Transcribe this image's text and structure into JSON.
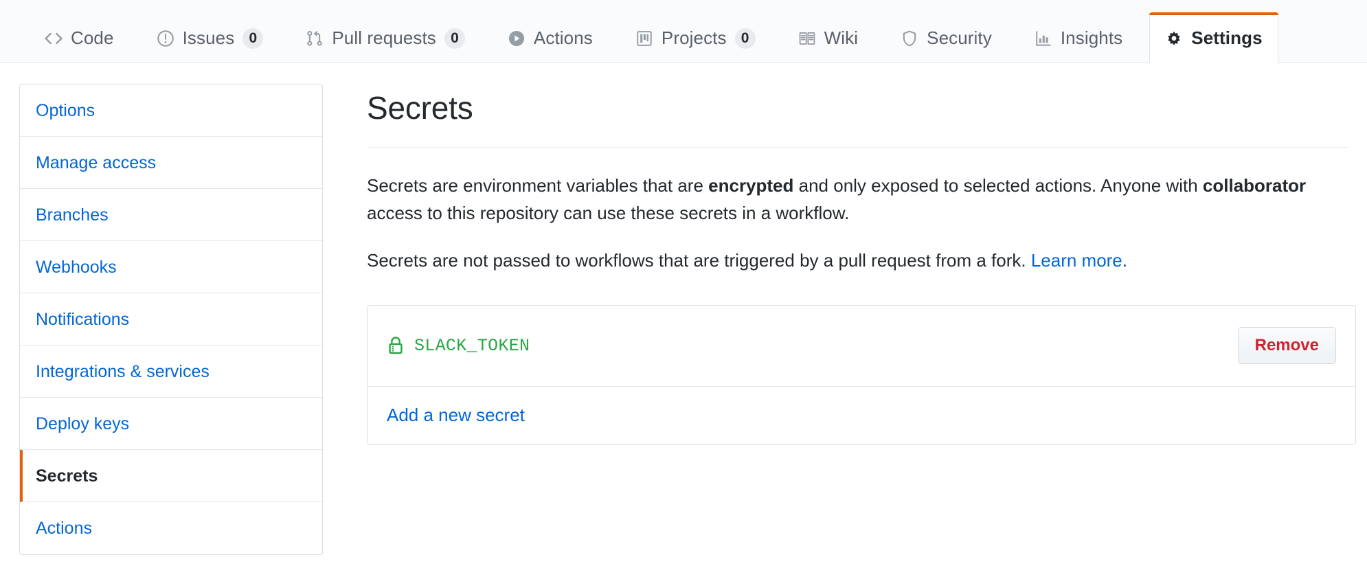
{
  "repo_nav": {
    "tabs": [
      {
        "label": "Code",
        "icon": "code-icon",
        "count": null,
        "selected": false
      },
      {
        "label": "Issues",
        "icon": "issue-opened-icon",
        "count": "0",
        "selected": false
      },
      {
        "label": "Pull requests",
        "icon": "git-pull-request-icon",
        "count": "0",
        "selected": false
      },
      {
        "label": "Actions",
        "icon": "play-icon",
        "count": null,
        "selected": false
      },
      {
        "label": "Projects",
        "icon": "project-board-icon",
        "count": "0",
        "selected": false
      },
      {
        "label": "Wiki",
        "icon": "book-icon",
        "count": null,
        "selected": false
      },
      {
        "label": "Security",
        "icon": "shield-icon",
        "count": null,
        "selected": false
      },
      {
        "label": "Insights",
        "icon": "graph-icon",
        "count": null,
        "selected": false
      },
      {
        "label": "Settings",
        "icon": "gear-icon",
        "count": null,
        "selected": true
      }
    ],
    "active_tab_accent": "#e36209"
  },
  "sidebar": {
    "items": [
      {
        "label": "Options",
        "selected": false
      },
      {
        "label": "Manage access",
        "selected": false
      },
      {
        "label": "Branches",
        "selected": false
      },
      {
        "label": "Webhooks",
        "selected": false
      },
      {
        "label": "Notifications",
        "selected": false
      },
      {
        "label": "Integrations & services",
        "selected": false
      },
      {
        "label": "Deploy keys",
        "selected": false
      },
      {
        "label": "Secrets",
        "selected": true
      },
      {
        "label": "Actions",
        "selected": false
      }
    ],
    "selected_accent": "#e36209",
    "link_color": "#0366d6"
  },
  "main": {
    "title": "Secrets",
    "paragraph_1": {
      "part_1": "Secrets are environment variables that are ",
      "bold_1": "encrypted",
      "part_2": " and only exposed to selected actions. Anyone with ",
      "bold_2": "collaborator",
      "part_3": " access to this repository can use these secrets in a workflow."
    },
    "paragraph_2": {
      "part_1": "Secrets are not passed to workflows that are triggered by a pull request from a fork. ",
      "link_text": "Learn more",
      "part_2": "."
    },
    "secrets": [
      {
        "name": "SLACK_TOKEN",
        "icon": "lock-icon",
        "icon_color": "#28a745",
        "remove_label": "Remove"
      }
    ],
    "add_secret_label": "Add a new secret",
    "remove_button_color": "#cb2431"
  }
}
